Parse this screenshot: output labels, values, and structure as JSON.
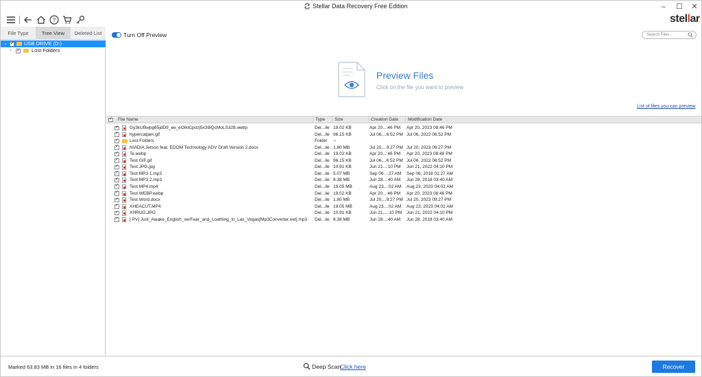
{
  "window": {
    "title": "Stellar Data Recovery Free Edition",
    "brand_pre": "stel",
    "brand_accent": "l",
    "brand_post": "ar",
    "accent_color": "#1e7ae0"
  },
  "toolbar": {
    "icons": [
      "menu-icon",
      "back-icon",
      "home-icon",
      "help-icon",
      "cart-icon",
      "key-icon"
    ]
  },
  "left_panel": {
    "tabs": [
      {
        "label": "File Type"
      },
      {
        "label": "Tree View",
        "active": true
      },
      {
        "label": "Deleted List"
      }
    ],
    "tree": [
      {
        "label": "USB DRIVE (D:)",
        "selected": true
      },
      {
        "label": "Lost Folders",
        "selected": false
      }
    ]
  },
  "preview": {
    "toggle_label": "Turn Off Preview",
    "search_placeholder": "Search Files...",
    "title": "Preview Files",
    "subtitle": "Click on the file you want to preview",
    "list_link": "List of files you can preview"
  },
  "table": {
    "headers": [
      "File Name",
      "Type",
      "Size",
      "Creation Date",
      "Modification Date"
    ],
    "rows": [
      {
        "name": "Gy3kUBwpg65jdD9_ee_eOiktCpozj5x39iQcMoLS328.webp",
        "type": "Del...ile",
        "size": "19.02 KB",
        "created": "Apr 20...:46 PM",
        "modified": "Apr 20, 2023 08:46 PM",
        "icon": "file"
      },
      {
        "name": "hypercatjam.gif",
        "type": "Del...ile",
        "size": "96.15 KB",
        "created": "Jul 06,...6:52 PM",
        "modified": "Jul 06, 2022 06:52 PM",
        "icon": "file"
      },
      {
        "name": "Lost Folders",
        "type": "Folder",
        "size": "--",
        "created": "",
        "modified": "",
        "icon": "folder"
      },
      {
        "name": "NVIDIA Jetson feat. EDOM Technology ADV Draft Version 2.docx",
        "type": "Del...ile",
        "size": "1.80 MB",
        "created": "Jul 20,...9:27 PM",
        "modified": "Jul 20, 2023 09:27 PM",
        "icon": "file"
      },
      {
        "name": "Te.webp",
        "type": "Del...ile",
        "size": "19.02 KB",
        "created": "Apr 20...:46 PM",
        "modified": "Apr 20, 2023 08:46 PM",
        "icon": "file"
      },
      {
        "name": "Test GIF.gif",
        "type": "Del...ile",
        "size": "96.15 KB",
        "created": "Jul 06,...6:52 PM",
        "modified": "Jul 06, 2022 06:52 PM",
        "icon": "file"
      },
      {
        "name": "Test JPG.jpg",
        "type": "Del...ile",
        "size": "10.91 KB",
        "created": "Jun 21...:10 PM",
        "modified": "Jun 21, 2022 04:10 PM",
        "icon": "file"
      },
      {
        "name": "Test MP3 1.mp3",
        "type": "Del...ile",
        "size": "5.07 MB",
        "created": "Sep 06...:27 AM",
        "modified": "Sep 06, 2018 01:27 AM",
        "icon": "file"
      },
      {
        "name": "Test MP3 2.mp3",
        "type": "Del...ile",
        "size": "8.38 MB",
        "created": "Jun 28...:40 AM",
        "modified": "Jun 28, 2018 03:40 AM",
        "icon": "file"
      },
      {
        "name": "Test MP4.mp4",
        "type": "Del...ile",
        "size": "19.05 MB",
        "created": "Aug 23...:02 AM",
        "modified": "Aug 23, 2023 04:02 AM",
        "icon": "file"
      },
      {
        "name": "Test WEBP.webp",
        "type": "Del...ile",
        "size": "19.02 KB",
        "created": "Apr 20...:46 PM",
        "modified": "Apr 20, 2023 08:46 PM",
        "icon": "file"
      },
      {
        "name": "Test Word.docx",
        "type": "Del...ile",
        "size": "1.80 MB",
        "created": "Jul 20,...9:27 PM",
        "modified": "Jul 20, 2023 09:27 PM",
        "icon": "file"
      },
      {
        "name": "XHEACUT.MP4",
        "type": "Del...ile",
        "size": "19.05 MB",
        "created": "Aug 23...:02 AM",
        "modified": "Aug 23, 2023 04:02 AM",
        "icon": "file"
      },
      {
        "name": "XHRUG.JPG",
        "type": "Del...ile",
        "size": "10.91 KB",
        "created": "Jun 21,...:10 PM",
        "modified": "Jun 21, 2022 04:10 PM",
        "icon": "file"
      },
      {
        "name": "[ PV] Just_Awake_English_verFear_and_Loathing_in_Las_Vegas[Mp3Converter.net].mp3",
        "type": "Del...ile",
        "size": "8.38 MB",
        "created": "Jun 28...:40 AM",
        "modified": "Jun 28, 2018 03:40 AM",
        "icon": "file"
      }
    ]
  },
  "status": {
    "marked_text": "Marked 63.83 MB in 16 files in 4 folders",
    "deep_scan_label": "Deep Scan",
    "deep_scan_link": "Click here",
    "recover_label": "Recover"
  }
}
